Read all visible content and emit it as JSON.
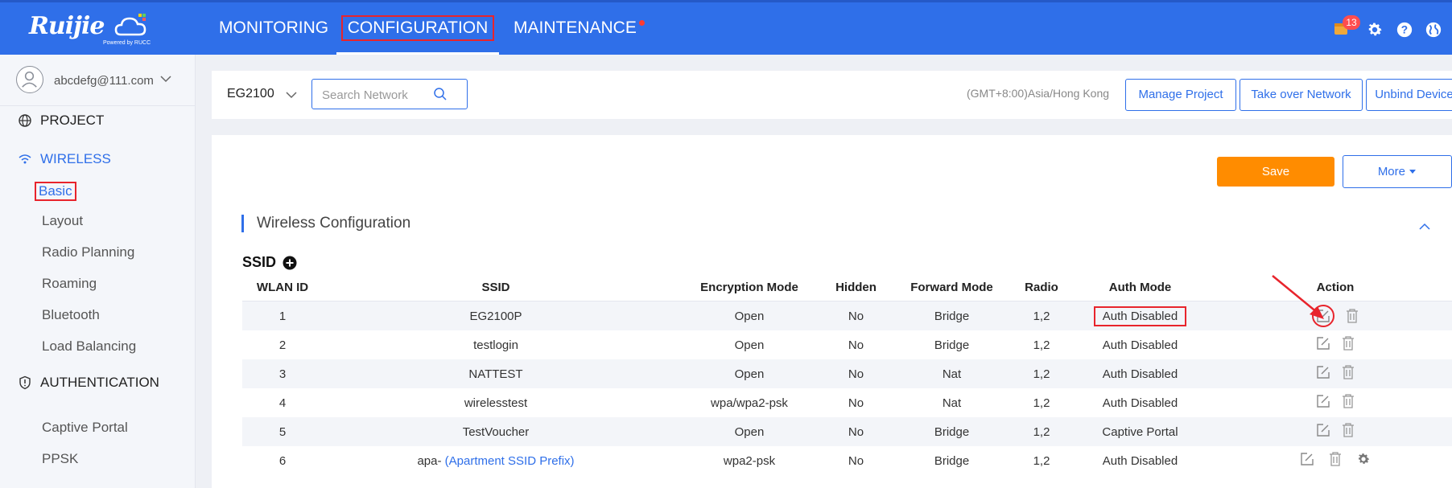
{
  "brand": {
    "logo_text": "Ruijie",
    "logo_sub": "Powered by RUCC"
  },
  "nav": {
    "monitoring": "MONITORING",
    "configuration": "CONFIGURATION",
    "maintenance": "MAINTENANCE"
  },
  "top_icons": {
    "notification_count": "13"
  },
  "user": {
    "email": "abcdefg@111.com"
  },
  "sidebar": {
    "project": "PROJECT",
    "wireless": "WIRELESS",
    "wireless_items": [
      "Basic",
      "Layout",
      "Radio Planning",
      "Roaming",
      "Bluetooth",
      "Load Balancing"
    ],
    "authentication": "AUTHENTICATION",
    "auth_items": [
      "Captive Portal",
      "PPSK"
    ]
  },
  "network_bar": {
    "network_name": "EG2100",
    "search_placeholder": "Search Network",
    "timezone": "(GMT+8:00)Asia/Hong  Kong",
    "manage_project": "Manage Project",
    "take_over": "Take over Network",
    "unbind": "Unbind Device"
  },
  "panel": {
    "save": "Save",
    "more": "More",
    "section_title": "Wireless Configuration",
    "ssid_title": "SSID"
  },
  "table": {
    "headers": [
      "WLAN ID",
      "SSID",
      "Encryption Mode",
      "Hidden",
      "Forward Mode",
      "Radio",
      "Auth Mode",
      "Action"
    ],
    "rows": [
      {
        "id": "1",
        "ssid": "EG2100P",
        "enc": "Open",
        "hidden": "No",
        "forward": "Bridge",
        "radio": "1,2",
        "auth": "Auth Disabled"
      },
      {
        "id": "2",
        "ssid": "testlogin",
        "enc": "Open",
        "hidden": "No",
        "forward": "Bridge",
        "radio": "1,2",
        "auth": "Auth Disabled"
      },
      {
        "id": "3",
        "ssid": "NATTEST",
        "enc": "Open",
        "hidden": "No",
        "forward": "Nat",
        "radio": "1,2",
        "auth": "Auth Disabled"
      },
      {
        "id": "4",
        "ssid": "wirelesstest",
        "enc": "wpa/wpa2-psk",
        "hidden": "No",
        "forward": "Nat",
        "radio": "1,2",
        "auth": "Auth Disabled"
      },
      {
        "id": "5",
        "ssid": "TestVoucher",
        "enc": "Open",
        "hidden": "No",
        "forward": "Bridge",
        "radio": "1,2",
        "auth": "Captive Portal"
      },
      {
        "id": "6",
        "ssid": "apa-",
        "ssid_suffix": "(Apartment SSID Prefix)",
        "enc": "wpa2-psk",
        "hidden": "No",
        "forward": "Bridge",
        "radio": "1,2",
        "auth": "Auth Disabled"
      }
    ]
  },
  "colors": {
    "primary": "#2f6fe9",
    "accent": "#ff8c00",
    "highlight": "#e8242c"
  }
}
